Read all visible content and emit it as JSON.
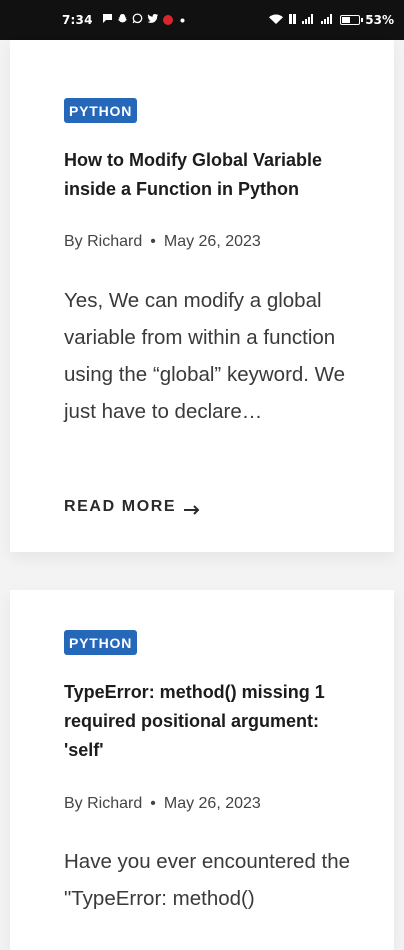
{
  "status_bar": {
    "time": "7:34",
    "icons": [
      "chat-bubble-icon",
      "snapchat-icon",
      "whatsapp-icon",
      "twitter-icon",
      "red-app-icon",
      "notification-dot-icon"
    ],
    "right_icons": [
      "wifi-icon",
      "hd-icon",
      "signal-icon",
      "signal-icon",
      "battery-icon"
    ],
    "battery_percent": "53%",
    "battery_level": 0.53
  },
  "posts": [
    {
      "category": "PYTHON",
      "title": "How to Modify Global Variable inside a Function in Python",
      "author": "By Richard",
      "separator": "•",
      "date": "May 26, 2023",
      "excerpt": "Yes, We can modify a global variable from within a function using the “global” keyword. We just have to declare…",
      "read_more": "READ MORE"
    },
    {
      "category": "PYTHON",
      "title": "TypeError: method() missing 1 required positional argument: 'self'",
      "author": "By Richard",
      "separator": "•",
      "date": "May 26, 2023",
      "excerpt": "Have you ever encountered the \"TypeError: method()"
    }
  ],
  "colors": {
    "badge": "#2567b9",
    "status_bar": "#111111",
    "background": "#f3f3f3"
  }
}
